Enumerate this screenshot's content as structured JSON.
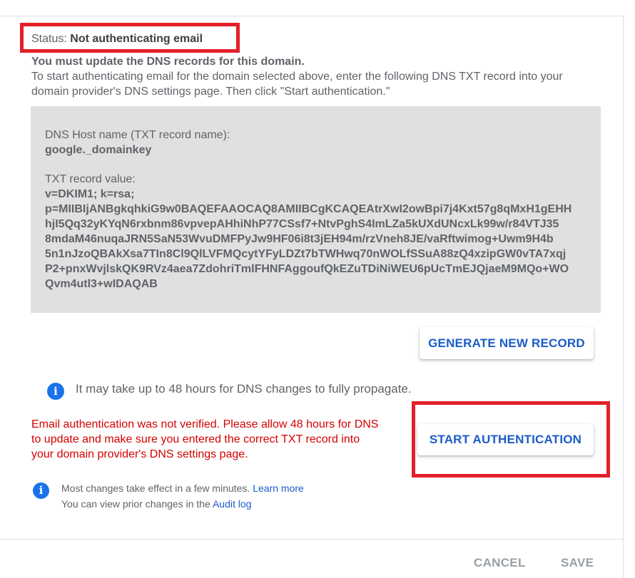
{
  "status": {
    "label": "Status:",
    "value": "Not authenticating email"
  },
  "heading": "You must update the DNS records for this domain.",
  "instructions": "To start authenticating email for the domain selected above, enter the following DNS TXT record into your domain provider's DNS settings page. Then click \"Start authentication.\"",
  "record": {
    "host_label": "DNS Host name (TXT record name):",
    "host_value": "google._domainkey",
    "txt_label": "TXT record value:",
    "txt_lines": [
      "v=DKIM1; k=rsa;",
      "p=MIIBIjANBgkqhkiG9w0BAQEFAAOCAQ8AMIIBCgKCAQEAtrXwI2owBpi7j4Kxt57g8qMxH1gEHH",
      "hjI5Qq32yKYqN6rxbnm86vpvepAHhiNhP77CSsf7+NtvPghS4ImLZa5kUXdUNcxLk99w/r84VTJ35",
      "8mdaM46nuqaJRN5SaN53WvuDMFPyJw9HF06i8t3jEH94m/rzVneh8JE/vaRftwimog+Uwm9H4b",
      "5n1nJzoQBAkXsa7TIn8Cl9QlLVFMQcytYFyLDZt7bTWHwq70nWOLfSSuA88zQ4xzipGW0vTA7xqj",
      "P2+pnxWvjlskQK9RVz4aea7ZdohriTmlFHNFAggoufQkEZuTDiNiWEU6pUcTmEJQjaeM9MQo+WO",
      "Qvm4utl3+wIDAQAB"
    ]
  },
  "buttons": {
    "generate": "GENERATE NEW RECORD",
    "start": "START AUTHENTICATION"
  },
  "propagate_note": "It may take up to 48 hours for DNS changes to fully propagate.",
  "error_lines": [
    "Email authentication was not verified. Please allow 48 hours for DNS",
    "to update and make sure you entered the correct TXT record into",
    "your domain provider's DNS settings page."
  ],
  "changes_note": {
    "line1_text": "Most changes take effect in a few minutes.",
    "learn_more": "Learn more",
    "line2_text": "You can view prior changes in the",
    "audit_log": "Audit log"
  },
  "footer": {
    "cancel": "CANCEL",
    "save": "SAVE"
  },
  "colors": {
    "accent": "#1a73e8",
    "error": "#d50000",
    "highlight": "#e3202a",
    "record_bg": "#e0e0e0"
  },
  "icons": {
    "info": "info-icon"
  }
}
